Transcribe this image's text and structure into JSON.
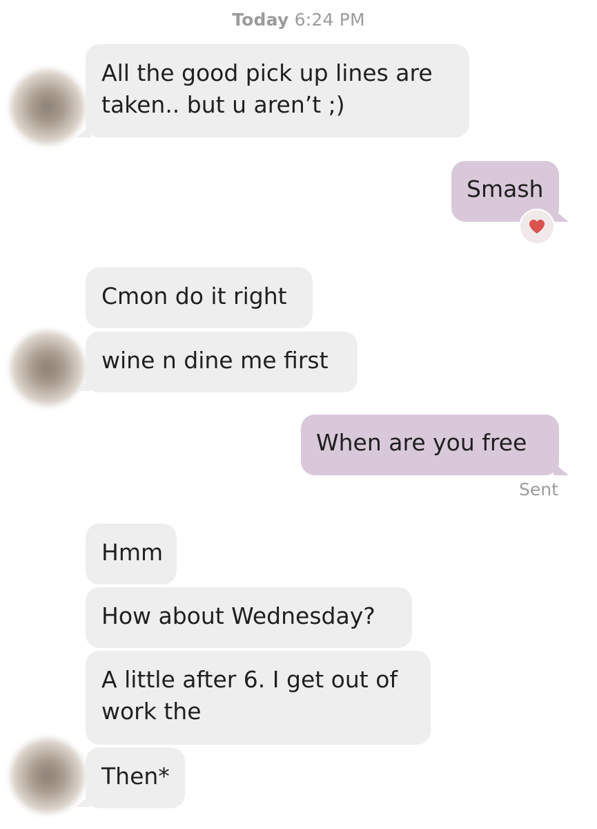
{
  "header": {
    "day": "Today",
    "time": "6:24 PM"
  },
  "messages": [
    {
      "sender": "them",
      "text": "All the good pick up lines are\ntaken.. but u aren’t ;)"
    },
    {
      "sender": "me",
      "text": "Smash",
      "reaction": "heart-icon"
    },
    {
      "sender": "them",
      "text": "Cmon do it right"
    },
    {
      "sender": "them",
      "text": "wine n dine me first"
    },
    {
      "sender": "me",
      "text": "When are you free",
      "status": "Sent"
    },
    {
      "sender": "them",
      "text": "Hmm"
    },
    {
      "sender": "them",
      "text": "How about Wednesday?"
    },
    {
      "sender": "them",
      "text": "A little after 6. I get out of\nwork the"
    },
    {
      "sender": "them",
      "text": "Then*"
    }
  ],
  "colors": {
    "incoming_bubble": "#eeeeee",
    "outgoing_bubble": "#d9c8da",
    "heart": "#d9534f",
    "meta_text": "#9b9b9b"
  }
}
